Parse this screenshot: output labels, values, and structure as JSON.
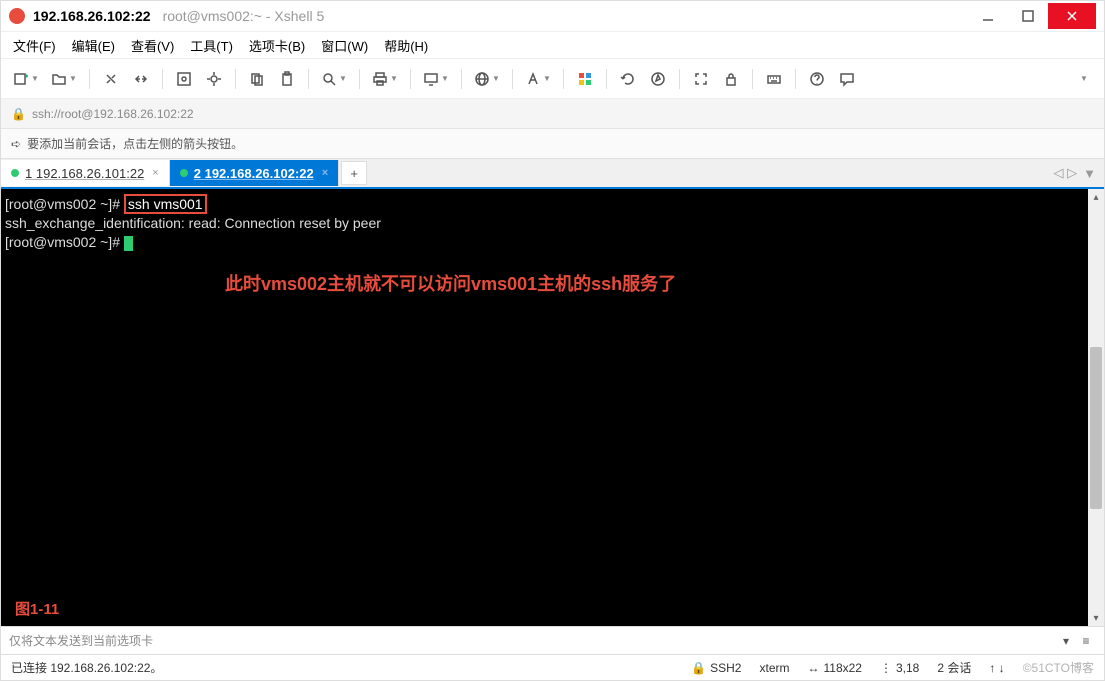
{
  "titlebar": {
    "title_bold": "192.168.26.102:22",
    "title_gray": "root@vms002:~ - Xshell 5"
  },
  "menu": {
    "file": "文件(F)",
    "edit": "编辑(E)",
    "view": "查看(V)",
    "tools": "工具(T)",
    "tabs": "选项卡(B)",
    "window": "窗口(W)",
    "help": "帮助(H)"
  },
  "addressbar": {
    "url": "ssh://root@192.168.26.102:22"
  },
  "tipbar": {
    "text": "要添加当前会话，点击左侧的箭头按钮。"
  },
  "tabs": {
    "tab1": {
      "num": "1",
      "label": "192.168.26.101:22"
    },
    "tab2": {
      "num": "2",
      "label": "192.168.26.102:22"
    },
    "add": "+"
  },
  "terminal": {
    "line1_prompt": "[root@vms002 ~]# ",
    "line1_cmd": "ssh vms001",
    "line2": "ssh_exchange_identification: read: Connection reset by peer",
    "line3_prompt": "[root@vms002 ~]# ",
    "annotation": "此时vms002主机就不可以访问vms001主机的ssh服务了",
    "figlabel": "图1-11"
  },
  "inputbar": {
    "placeholder": "仅将文本发送到当前选项卡"
  },
  "statusbar": {
    "connected": "已连接 192.168.26.102:22。",
    "proto": "SSH2",
    "term": "xterm",
    "size": "118x22",
    "pos": "3,18",
    "sessions": "2 会话",
    "watermark": "©51CTO博客"
  }
}
